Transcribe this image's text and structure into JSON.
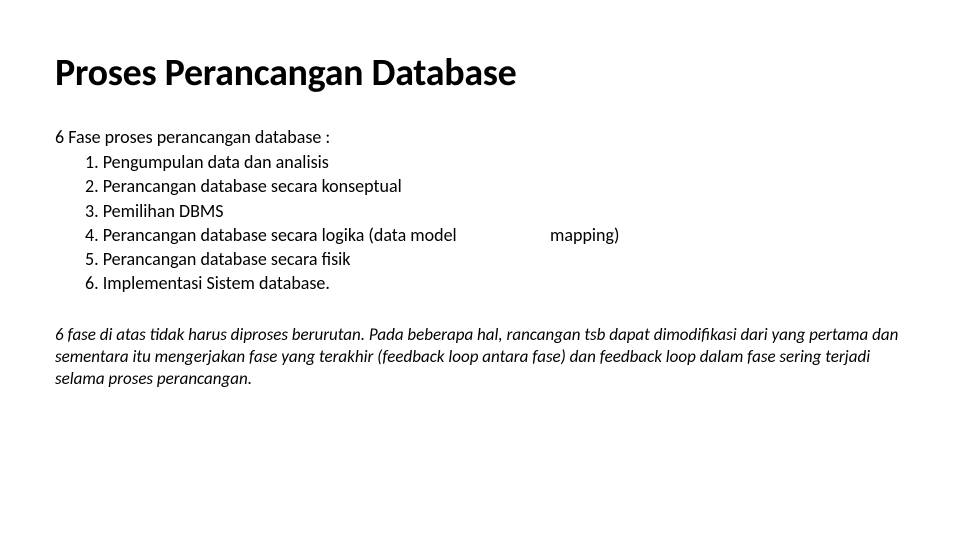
{
  "title": "Proses Perancangan Database",
  "intro": "6 Fase proses perancangan database :",
  "items": {
    "i1": "1. Pengumpulan data dan analisis",
    "i2": "2. Perancangan database secara konseptual",
    "i3": "3. Pemilihan DBMS",
    "i4_left": "4. Perancangan database secara logika (data model",
    "i4_right": "mapping)",
    "i5": "5. Perancangan database secara fisik",
    "i6": "6. Implementasi Sistem database."
  },
  "note": "6 fase di atas tidak harus diproses berurutan. Pada beberapa hal, rancangan tsb dapat dimodifikasi dari yang pertama dan sementara itu mengerjakan fase yang terakhir (feedback loop antara fase) dan feedback loop dalam fase sering terjadi selama proses perancangan."
}
